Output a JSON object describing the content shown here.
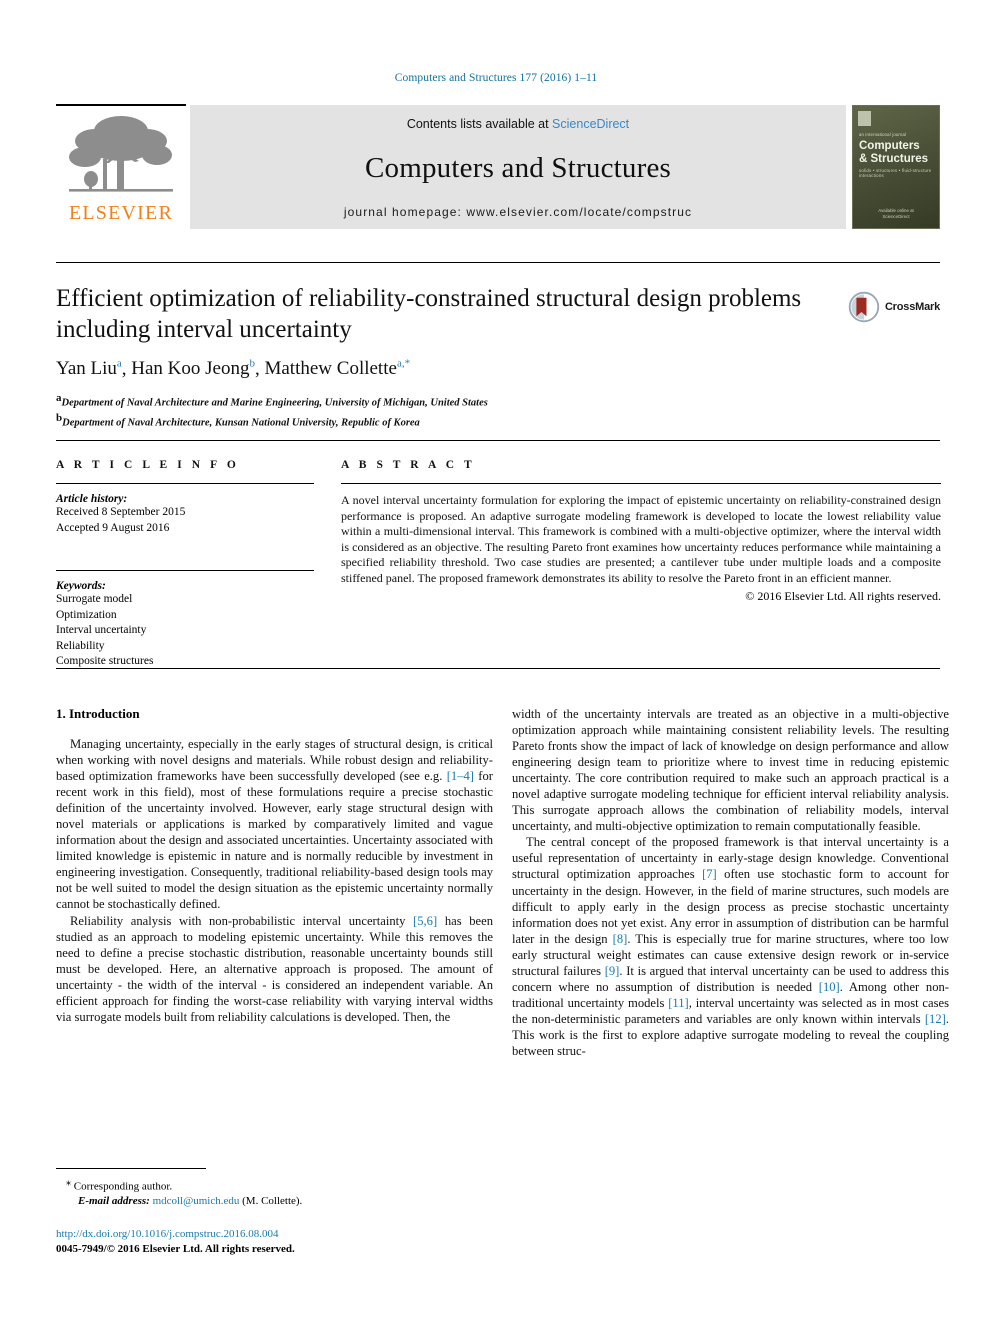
{
  "running_head": "Computers and Structures 177 (2016) 1–11",
  "masthead": {
    "publisher_logo_label": "ELSEVIER",
    "contents_prefix": "Contents lists available at ",
    "contents_link": "ScienceDirect",
    "journal_title": "Computers and Structures",
    "journal_homepage": "journal homepage: www.elsevier.com/locate/compstruc",
    "cover": {
      "supertitle": "an international journal",
      "title_line1": "Computers",
      "title_line2": "& Structures",
      "subtitle": "solids • structures • fluid-structure interactions",
      "footer_line1": "Available online at",
      "footer_line2": "ScienceDirect"
    }
  },
  "article": {
    "title": "Efficient optimization of reliability-constrained structural design problems including interval uncertainty",
    "authors": [
      {
        "name": "Yan Liu",
        "sup": "a"
      },
      {
        "name": "Han Koo Jeong",
        "sup": "b"
      },
      {
        "name": "Matthew Collette",
        "sup": "a,*"
      }
    ],
    "authors_line": "Yan Liu a, Han Koo Jeong b, Matthew Collette a,*",
    "affiliations": [
      {
        "marker": "a",
        "text": "Department of Naval Architecture and Marine Engineering, University of Michigan, United States"
      },
      {
        "marker": "b",
        "text": "Department of Naval Architecture, Kunsan National University, Republic of Korea"
      }
    ],
    "crossmark_label": "CrossMark"
  },
  "article_info": {
    "heading": "A R T I C L E    I N F O",
    "history_heading": "Article history:",
    "history_lines": [
      "Received 8 September 2015",
      "Accepted 9 August 2016"
    ],
    "keywords_heading": "Keywords:",
    "keywords": [
      "Surrogate model",
      "Optimization",
      "Interval uncertainty",
      "Reliability",
      "Composite structures"
    ]
  },
  "abstract": {
    "heading": "A B S T R A C T",
    "body": "A novel interval uncertainty formulation for exploring the impact of epistemic uncertainty on reliability-constrained design performance is proposed. An adaptive surrogate modeling framework is developed to locate the lowest reliability value within a multi-dimensional interval. This framework is combined with a multi-objective optimizer, where the interval width is considered as an objective. The resulting Pareto front examines how uncertainty reduces performance while maintaining a specified reliability threshold. Two case studies are presented; a cantilever tube under multiple loads and a composite stiffened panel. The proposed framework demonstrates its ability to resolve the Pareto front in an efficient manner.",
    "copyright": "© 2016 Elsevier Ltd. All rights reserved."
  },
  "body": {
    "section_heading": "1. Introduction",
    "left_paragraphs": [
      {
        "segments": [
          {
            "text": "Managing uncertainty, especially in the early stages of structural design, is critical when working with novel designs and materials. While robust design and reliability-based optimization frameworks have been successfully developed (see e.g. "
          },
          {
            "text": "[1–4]",
            "ref": true
          },
          {
            "text": " for recent work in this field), most of these formulations require a precise stochastic definition of the uncertainty involved. However, early stage structural design with novel materials or applications is marked by comparatively limited and vague information about the design and associated uncertainties. Uncertainty associated with limited knowledge is epistemic in nature and is normally reducible by investment in engineering investigation. Consequently, traditional reliability-based design tools may not be well suited to model the design situation as the epistemic uncertainty normally cannot be stochastically defined."
          }
        ]
      },
      {
        "segments": [
          {
            "text": "Reliability analysis with non-probabilistic interval uncertainty "
          },
          {
            "text": "[5,6]",
            "ref": true
          },
          {
            "text": " has been studied as an approach to modeling epistemic uncertainty. While this removes the need to define a precise stochastic distribution, reasonable uncertainty bounds still must be developed. Here, an alternative approach is proposed. The amount of uncertainty - the width of the interval - is considered an independent variable. An efficient approach for finding the worst-case reliability with varying interval widths via surrogate models built from reliability calculations is developed. Then, the"
          }
        ]
      }
    ],
    "right_paragraphs": [
      {
        "segments": [
          {
            "text": "width of the uncertainty intervals are treated as an objective in a multi-objective optimization approach while maintaining consistent reliability levels. The resulting Pareto fronts show the impact of lack of knowledge on design performance and allow engineering design team to prioritize where to invest time in reducing epistemic uncertainty. The core contribution required to make such an approach practical is a novel adaptive surrogate modeling technique for efficient interval reliability analysis. This surrogate approach allows the combination of reliability models, interval uncertainty, and multi-objective optimization to remain computationally feasible."
          }
        ]
      },
      {
        "segments": [
          {
            "text": "The central concept of the proposed framework is that interval uncertainty is a useful representation of uncertainty in early-stage design knowledge. Conventional structural optimization approaches "
          },
          {
            "text": "[7]",
            "ref": true
          },
          {
            "text": " often use stochastic form to account for uncertainty in the design. However, in the field of marine structures, such models are difficult to apply early in the design process as precise stochastic uncertainty information does not yet exist. Any error in assumption of distribution can be harmful later in the design "
          },
          {
            "text": "[8]",
            "ref": true
          },
          {
            "text": ". This is especially true for marine structures, where too low early structural weight estimates can cause extensive design rework or in-service structural failures "
          },
          {
            "text": "[9]",
            "ref": true
          },
          {
            "text": ". It is argued that interval uncertainty can be used to address this concern where no assumption of distribution is needed "
          },
          {
            "text": "[10]",
            "ref": true
          },
          {
            "text": ". Among other non-traditional uncertainty models "
          },
          {
            "text": "[11]",
            "ref": true
          },
          {
            "text": ", interval uncertainty was selected as in most cases the non-deterministic parameters and variables are only known within intervals "
          },
          {
            "text": "[12]",
            "ref": true
          },
          {
            "text": ". This work is the first to explore adaptive surrogate modeling to reveal the coupling between struc-"
          }
        ]
      }
    ]
  },
  "footnotes": {
    "corresponding_marker": "⁎",
    "corresponding_text": "Corresponding author.",
    "email_label": "E-mail address:",
    "email_address": "mdcoll@umich.edu",
    "email_owner": "(M. Collette)."
  },
  "footer": {
    "doi": "http://dx.doi.org/10.1016/j.compstruc.2016.08.004",
    "issn_line": "0045-7949/© 2016 Elsevier Ltd. All rights reserved."
  },
  "colors": {
    "link_blue": "#1a7aad",
    "elsevier_orange": "#f08019",
    "sciencedirect_blue": "#3a87c8",
    "band_gray": "#e3e3e3"
  }
}
